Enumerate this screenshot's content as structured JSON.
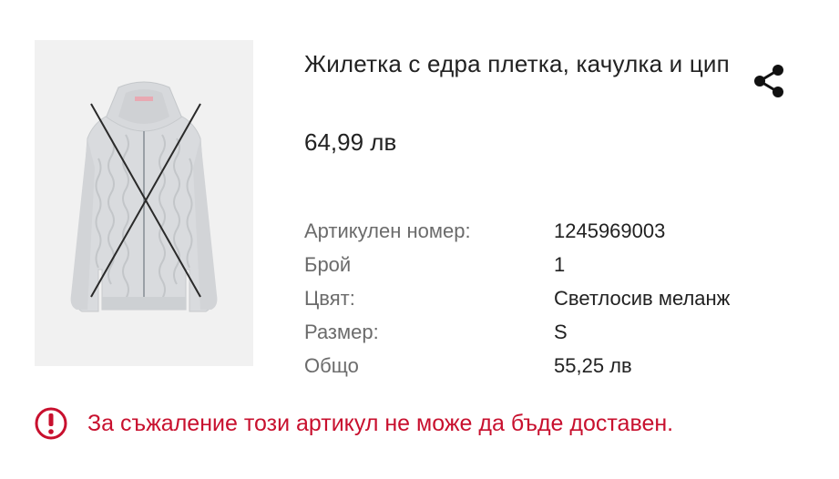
{
  "product": {
    "title": "Жилетка с едра плетка, качулка и цип",
    "price": "64,99 лв",
    "image_icon": "cardigan-crossed-out"
  },
  "share": {
    "icon": "share-icon"
  },
  "details": {
    "article_label": "Артикулен номер:",
    "article_value": "1245969003",
    "quantity_label": "Брой",
    "quantity_value": "1",
    "color_label": "Цвят:",
    "color_value": "Светлосив меланж",
    "size_label": "Размер:",
    "size_value": "S",
    "total_label": "Общо",
    "total_value": "55,25 лв"
  },
  "alert": {
    "icon": "warning-icon",
    "text": "За съжаление този артикул не може да бъде доставен.",
    "color": "#c8102e"
  }
}
